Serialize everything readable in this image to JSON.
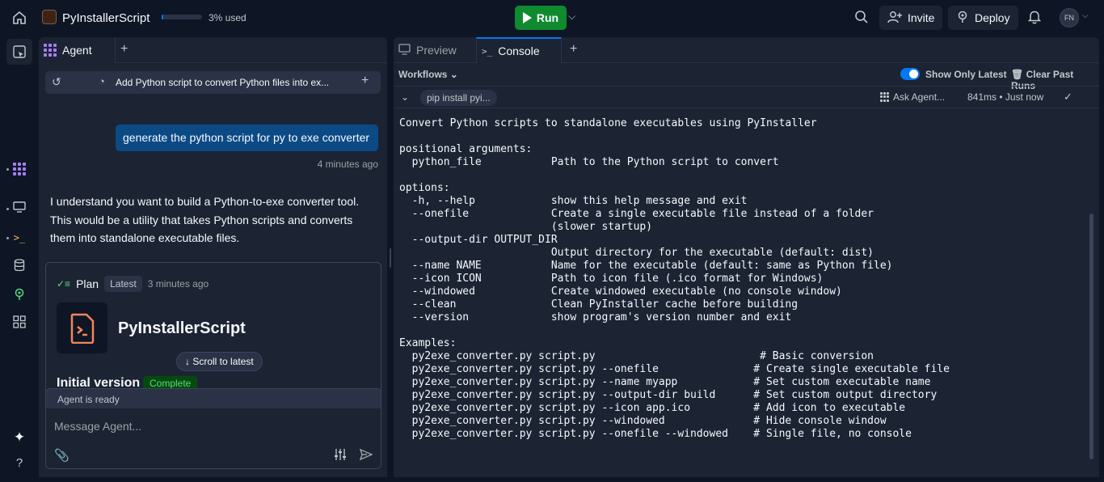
{
  "topbar": {
    "app_name": "PyInstallerScript",
    "usage_text": "3% used",
    "usage_fraction": 0.03,
    "run_label": "Run",
    "invite_label": "Invite",
    "deploy_label": "Deploy",
    "avatar_initials": "FN"
  },
  "agent_panel": {
    "tab_label": "Agent",
    "thread_title": "Add Python script to convert Python files into ex...",
    "user_message": "generate the python script for py to exe converter",
    "user_message_time": "4 minutes ago",
    "agent_message": "I understand you want to build a Python-to-exe converter tool. This would be a utility that takes Python scripts and converts them into standalone executable files.",
    "plan": {
      "label": "Plan",
      "badge": "Latest",
      "time": "3 minutes ago",
      "project_title": "PyInstallerScript",
      "scroll_label": "Scroll to latest",
      "version_label": "Initial version",
      "status_badge": "Complete"
    },
    "composer": {
      "status": "Agent is ready",
      "placeholder": "Message Agent..."
    }
  },
  "console_panel": {
    "tabs": [
      {
        "label": "Preview"
      },
      {
        "label": "Console"
      }
    ],
    "workflows_label": "Workflows",
    "show_only_latest_label": "Show Only Latest",
    "show_only_latest_on": true,
    "clear_past_runs_label": "Clear Past Runs",
    "run_command": "pip install pyi...",
    "ask_agent_label": "Ask Agent...",
    "run_duration": "841ms • Just now",
    "output_lines": [
      "Convert Python scripts to standalone executables using PyInstaller",
      "",
      "positional arguments:",
      "  python_file           Path to the Python script to convert",
      "",
      "options:",
      "  -h, --help            show this help message and exit",
      "  --onefile             Create a single executable file instead of a folder",
      "                        (slower startup)",
      "  --output-dir OUTPUT_DIR",
      "                        Output directory for the executable (default: dist)",
      "  --name NAME           Name for the executable (default: same as Python file)",
      "  --icon ICON           Path to icon file (.ico format for Windows)",
      "  --windowed            Create windowed executable (no console window)",
      "  --clean               Clean PyInstaller cache before building",
      "  --version             show program's version number and exit",
      "",
      "Examples:",
      "  py2exe_converter.py script.py                          # Basic conversion",
      "  py2exe_converter.py script.py --onefile               # Create single executable file",
      "  py2exe_converter.py script.py --name myapp            # Set custom executable name",
      "  py2exe_converter.py script.py --output-dir build      # Set custom output directory",
      "  py2exe_converter.py script.py --icon app.ico          # Add icon to executable",
      "  py2exe_converter.py script.py --windowed              # Hide console window",
      "  py2exe_converter.py script.py --onefile --windowed    # Single file, no console"
    ]
  },
  "colors": {
    "background": "#0e1525",
    "panel": "#1c2333",
    "accent": "#0079f2",
    "run_green": "#0f8a2f",
    "user_bubble": "#0c4a85",
    "app_icon": "#f0875a"
  },
  "icons": [
    "home-icon",
    "file-tree-icon",
    "agent-icon",
    "monitor-icon",
    "shell-icon",
    "database-icon",
    "deploy-icon",
    "apps-grid-icon",
    "sparkle-icon",
    "help-icon",
    "search-icon",
    "invite-icon",
    "bell-icon",
    "history-icon",
    "gauge-icon",
    "paperclip-icon",
    "sliders-icon",
    "send-icon",
    "checkmark-icon",
    "trash-icon"
  ]
}
